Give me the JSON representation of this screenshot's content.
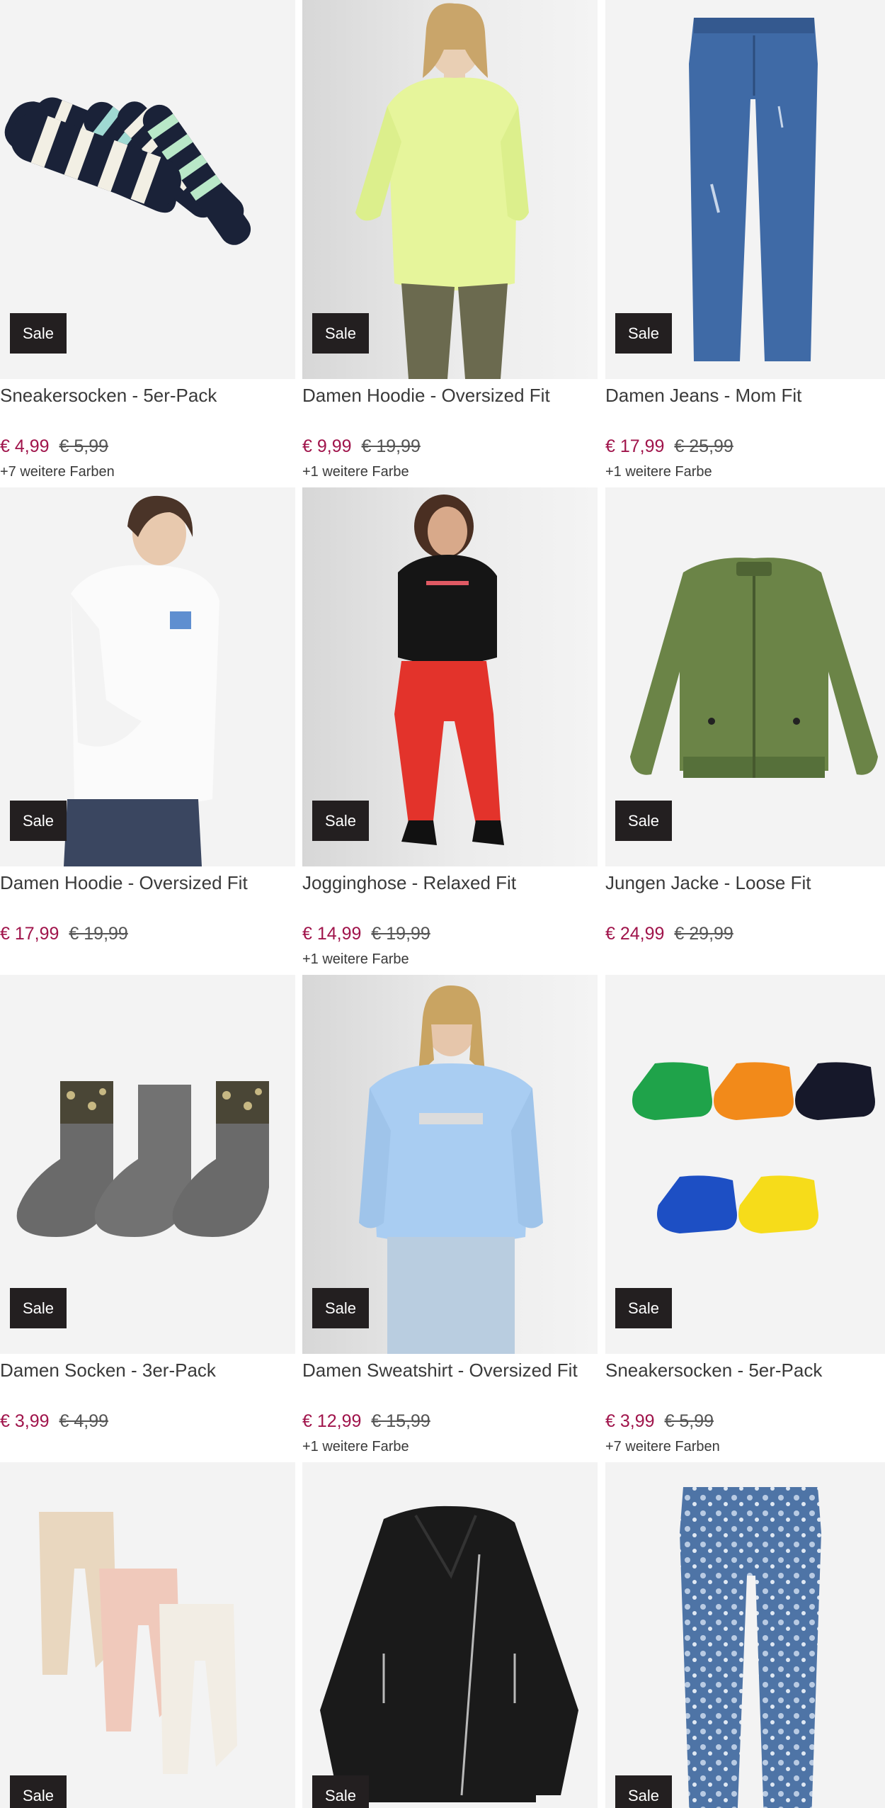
{
  "products": [
    {
      "title": "Sneakersocken - 5er-Pack",
      "badge": "Sale",
      "price": "€ 4,99",
      "old_price": "€ 5,99",
      "colors_note": "+7 weitere Farben",
      "image": "striped-socks"
    },
    {
      "title": "Damen Hoodie - Oversized Fit",
      "badge": "Sale",
      "price": "€ 9,99",
      "old_price": "€ 19,99",
      "colors_note": "+1 weitere Farbe",
      "image": "lime-hoodie"
    },
    {
      "title": "Damen Jeans - Mom Fit",
      "badge": "Sale",
      "price": "€ 17,99",
      "old_price": "€ 25,99",
      "colors_note": "+1 weitere Farbe",
      "image": "blue-jeans"
    },
    {
      "title": "Damen Hoodie - Oversized Fit",
      "badge": "Sale",
      "price": "€ 17,99",
      "old_price": "€ 19,99",
      "colors_note": "",
      "image": "white-hoodie"
    },
    {
      "title": "Jogginghose - Relaxed Fit",
      "badge": "Sale",
      "price": "€ 14,99",
      "old_price": "€ 19,99",
      "colors_note": "+1 weitere Farbe",
      "image": "red-joggers"
    },
    {
      "title": "Jungen Jacke - Loose Fit",
      "badge": "Sale",
      "price": "€ 24,99",
      "old_price": "€ 29,99",
      "colors_note": "",
      "image": "green-bomber-jacket"
    },
    {
      "title": "Damen Socken - 3er-Pack",
      "badge": "Sale",
      "price": "€ 3,99",
      "old_price": "€ 4,99",
      "colors_note": "",
      "image": "grey-leopard-socks"
    },
    {
      "title": "Damen Sweatshirt - Oversized Fit",
      "badge": "Sale",
      "price": "€ 12,99",
      "old_price": "€ 15,99",
      "colors_note": "+1 weitere Farbe",
      "image": "light-blue-sweatshirt"
    },
    {
      "title": "Sneakersocken - 5er-Pack",
      "badge": "Sale",
      "price": "€ 3,99",
      "old_price": "€ 5,99",
      "colors_note": "+7 weitere Farben",
      "image": "colorful-sneaker-socks"
    },
    {
      "title": "",
      "badge": "Sale",
      "price": "",
      "old_price": "",
      "colors_note": "",
      "image": "baby-leggings"
    },
    {
      "title": "",
      "badge": "Sale",
      "price": "",
      "old_price": "",
      "colors_note": "",
      "image": "black-leather-jacket"
    },
    {
      "title": "",
      "badge": "Sale",
      "price": "",
      "old_price": "",
      "colors_note": "",
      "image": "floral-jeans"
    }
  ],
  "colors": {
    "sale_price": "#a0144b",
    "badge_bg": "#231f20",
    "tile_bg": "#f2f2f2"
  }
}
